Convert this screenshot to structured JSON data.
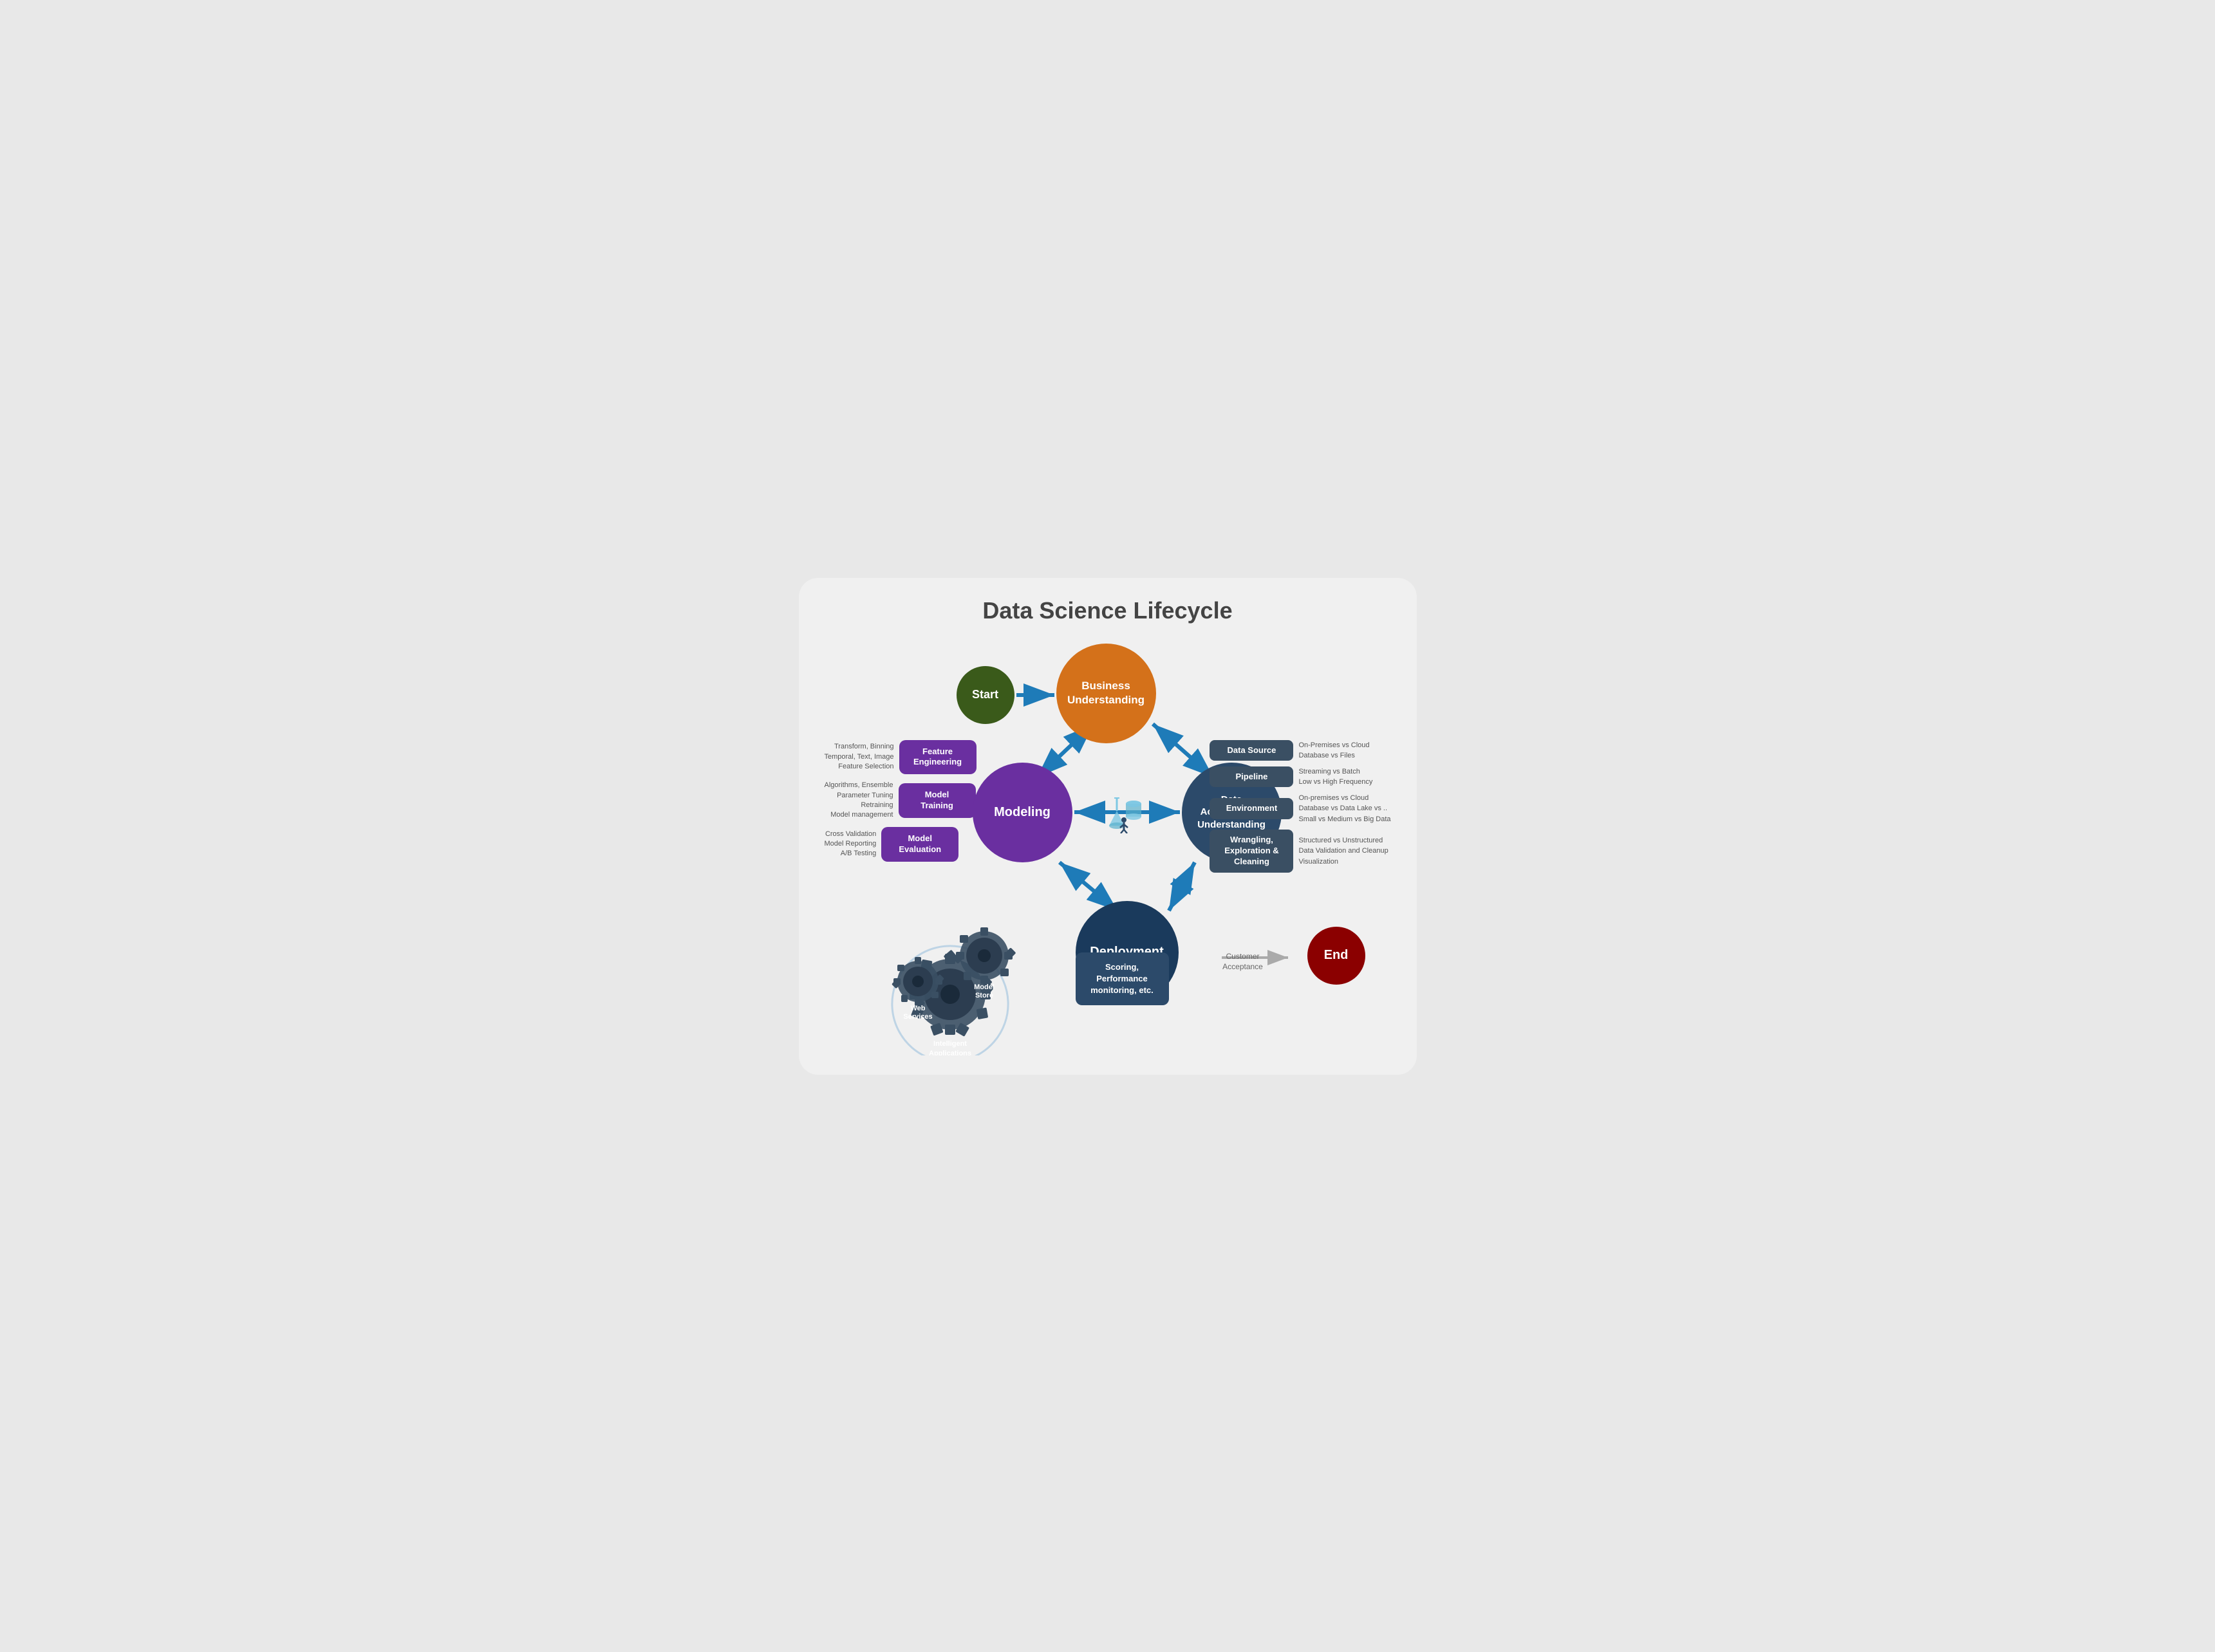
{
  "title": "Data Science Lifecycle",
  "circles": {
    "start": "Start",
    "business": "Business\nUnderstanding",
    "modeling": "Modeling",
    "data_acq": "Data\nAcquisition &\nUnderstanding",
    "deployment": "Deployment",
    "end": "End"
  },
  "left_items": [
    {
      "label": "Transform, Binning\nTemporal, Text, Image\nFeature Selection",
      "box": "Feature\nEngineering"
    },
    {
      "label": "Algorithms, Ensemble\nParameter Tuning\nRetraining\nModel management",
      "box": "Model\nTraining"
    },
    {
      "label": "Cross Validation\nModel Reporting\nA/B Testing",
      "box": "Model\nEvaluation"
    }
  ],
  "right_items": [
    {
      "box": "Data Source",
      "label": "On-Premises vs Cloud\nDatabase vs Files"
    },
    {
      "box": "Pipeline",
      "label": "Streaming vs Batch\nLow vs High Frequency"
    },
    {
      "box": "Environment",
      "label": "On-premises vs Cloud\nDatabase vs Data Lake vs ..\nSmall vs Medium vs Big Data"
    },
    {
      "box": "Wrangling,\nExploration &\nCleaning",
      "label": "Structured vs Unstructured\nData Validation and Cleanup\nVisualization"
    }
  ],
  "scoring_box": "Scoring,\nPerformance\nmonitoring, etc.",
  "customer_acceptance": "Customer\nAcceptance",
  "gear_labels": {
    "model_store": "Model\nStore",
    "web_services": "Web\nServices",
    "intelligent_apps": "Intelligent\nApplications"
  }
}
